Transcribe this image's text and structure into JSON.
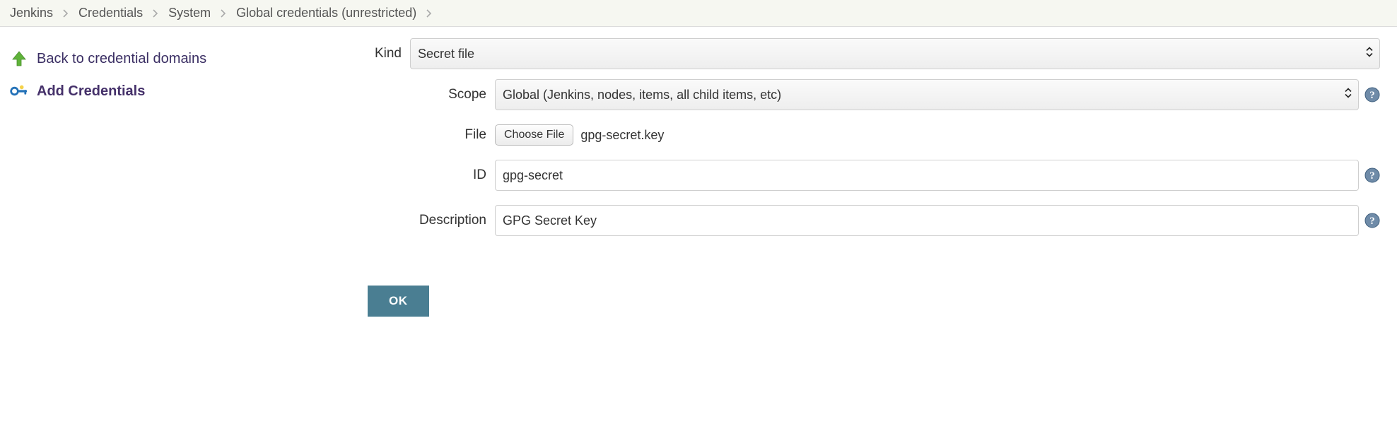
{
  "breadcrumbs": {
    "jenkins": "Jenkins",
    "credentials": "Credentials",
    "system": "System",
    "global": "Global credentials (unrestricted)"
  },
  "sidebar": {
    "back_label": "Back to credential domains",
    "add_label": "Add Credentials"
  },
  "form": {
    "kind_label": "Kind",
    "kind_value": "Secret file",
    "scope_label": "Scope",
    "scope_value": "Global (Jenkins, nodes, items, all child items, etc)",
    "file_label": "File",
    "choose_file_label": "Choose File",
    "file_name": "gpg-secret.key",
    "id_label": "ID",
    "id_value": "gpg-secret",
    "description_label": "Description",
    "description_value": "GPG Secret Key",
    "ok_label": "OK"
  }
}
